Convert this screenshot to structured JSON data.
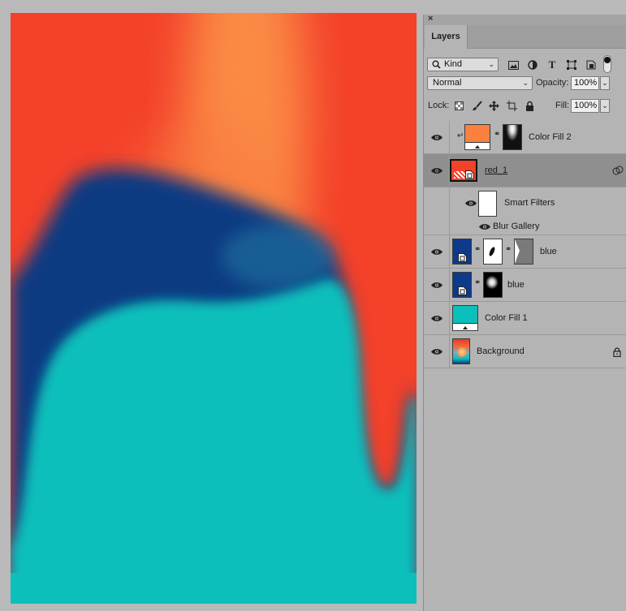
{
  "panel": {
    "title": "Layers",
    "close_glyph": "×",
    "filter": {
      "kind_label": "Kind",
      "icons": [
        "image-filter-icon",
        "adjustment-filter-icon",
        "type-filter-icon",
        "shape-filter-icon",
        "smartobject-filter-icon",
        "filter-toggle-icon"
      ]
    },
    "blend_mode": "Normal",
    "opacity_label": "Opacity:",
    "opacity_value": "100%",
    "lock_label": "Lock:",
    "fill_label": "Fill:",
    "fill_value": "100%"
  },
  "layers": [
    {
      "name": "Color Fill 2",
      "type": "fill",
      "color": "#fb8040",
      "clipped": true,
      "mask": "white-glow"
    },
    {
      "name": "red_1",
      "type": "smart-object",
      "selected": true,
      "color": "#f2422a"
    },
    {
      "name": "Smart Filters",
      "type": "smart-filters"
    },
    {
      "name": "Blur Gallery",
      "type": "filter"
    },
    {
      "name": "blue",
      "type": "smart-object",
      "color": "#0d3a8a",
      "mask": "streak",
      "vector_mask": true
    },
    {
      "name": "blue",
      "type": "smart-object",
      "color": "#0d3a8a",
      "mask": "blob"
    },
    {
      "name": "Color Fill 1",
      "type": "fill",
      "color": "#0bbfbb"
    },
    {
      "name": "Background",
      "type": "background",
      "locked": true
    }
  ],
  "colors": {
    "red": "#f5402a",
    "orange": "#fb8a45",
    "blue": "#0e3a82",
    "teal": "#0bbfbb",
    "panel": "#b4b4b4"
  }
}
